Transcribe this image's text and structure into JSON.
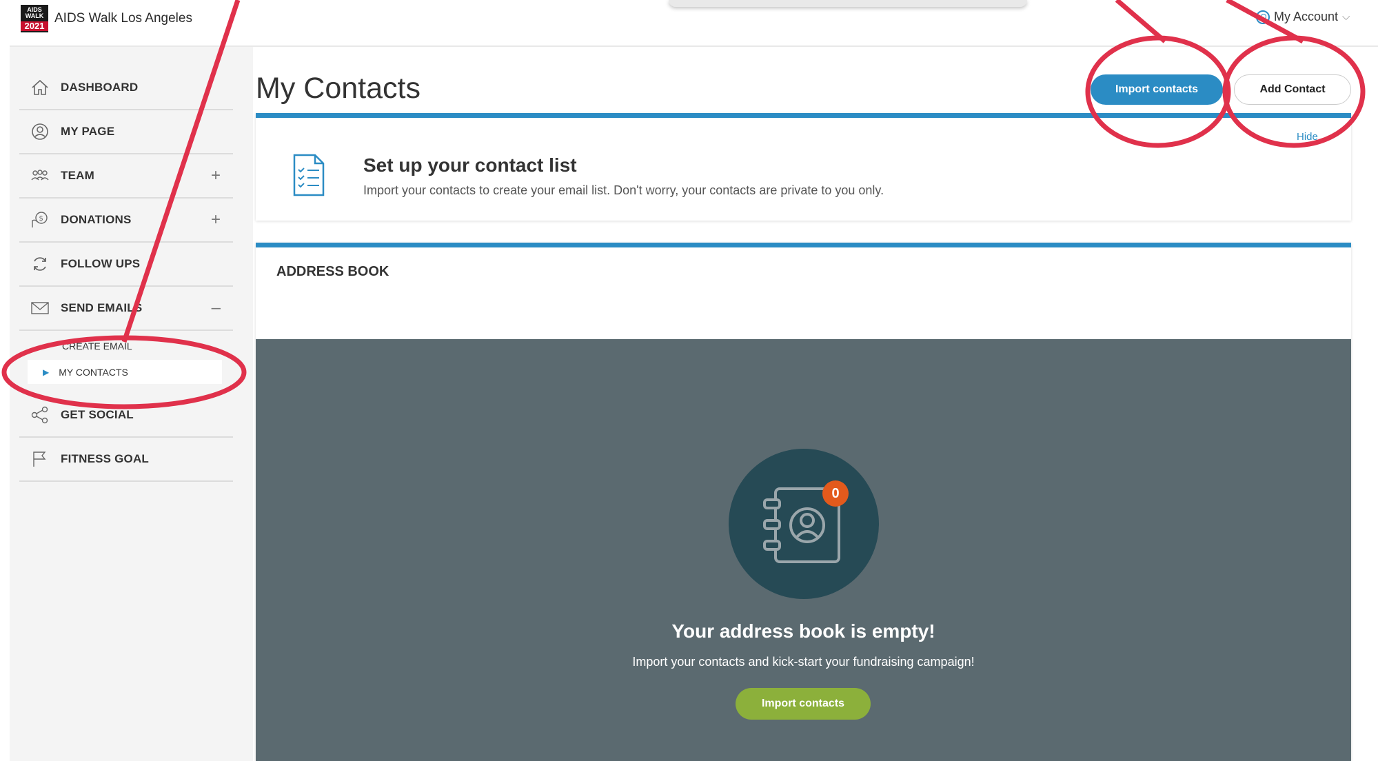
{
  "header": {
    "logo_top": "AIDS",
    "logo_mid": "WALK",
    "logo_year": "2021",
    "site_name": "AIDS Walk Los Angeles",
    "account_label": "My Account"
  },
  "sidebar": {
    "items": [
      {
        "label": "DASHBOARD",
        "icon": "home-icon"
      },
      {
        "label": "MY PAGE",
        "icon": "user-circle-icon"
      },
      {
        "label": "TEAM",
        "icon": "team-icon",
        "expand": "+"
      },
      {
        "label": "DONATIONS",
        "icon": "donation-icon",
        "expand": "+"
      },
      {
        "label": "FOLLOW UPS",
        "icon": "refresh-icon"
      },
      {
        "label": "SEND EMAILS",
        "icon": "envelope-icon",
        "expand": "–"
      },
      {
        "label": "GET SOCIAL",
        "icon": "share-icon"
      },
      {
        "label": "FITNESS GOAL",
        "icon": "flag-icon"
      }
    ],
    "sub_items": {
      "create_email": "CREATE EMAIL",
      "my_contacts": "MY CONTACTS"
    }
  },
  "main": {
    "title": "My Contacts",
    "import_button": "Import contacts",
    "add_button": "Add Contact",
    "setup": {
      "hide_label": "Hide",
      "title": "Set up your contact list",
      "description": "Import your contacts to create your email list. Don't worry, your contacts are private to you only."
    },
    "address_book": {
      "title": "ADDRESS BOOK",
      "badge_count": "0",
      "empty_title": "Your address book is empty!",
      "empty_description": "Import your contacts and kick-start your fundraising campaign!",
      "import_button": "Import contacts"
    }
  },
  "colors": {
    "accent_blue": "#2b8cc4",
    "annotation_red": "#e0314b",
    "green_button": "#8cb03b",
    "badge_orange": "#e35a1c",
    "panel_gray": "#5b6a70"
  }
}
